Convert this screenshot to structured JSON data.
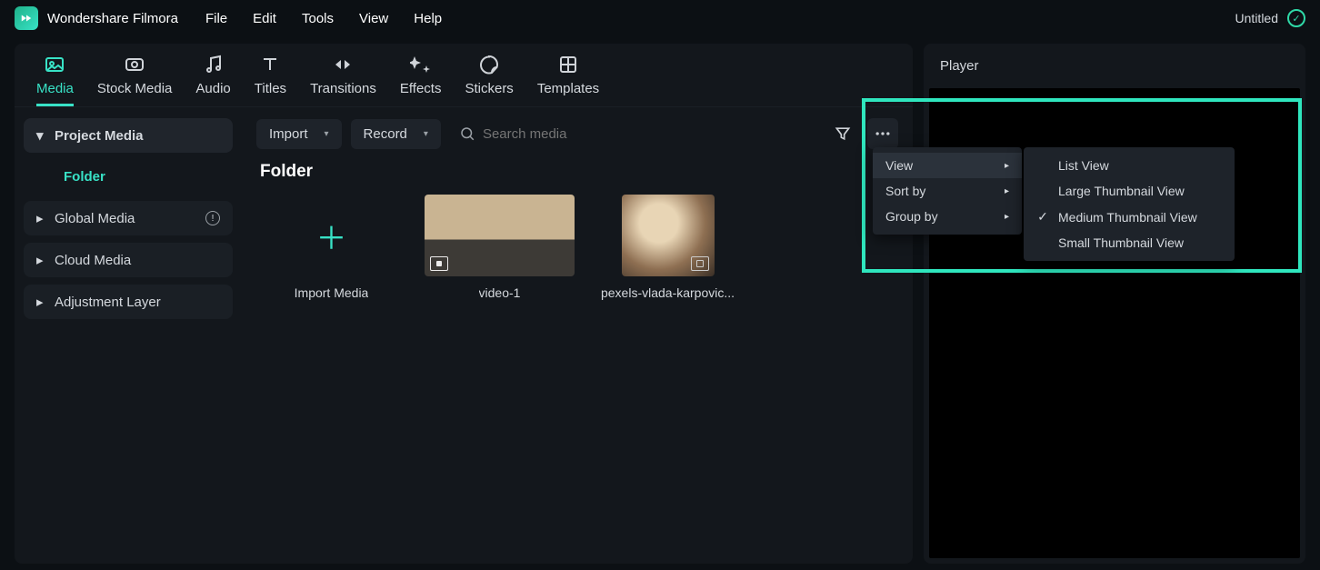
{
  "app_name": "Wondershare Filmora",
  "menu": [
    "File",
    "Edit",
    "Tools",
    "View",
    "Help"
  ],
  "project_title": "Untitled",
  "tabs": [
    {
      "label": "Media",
      "active": true
    },
    {
      "label": "Stock Media"
    },
    {
      "label": "Audio"
    },
    {
      "label": "Titles"
    },
    {
      "label": "Transitions"
    },
    {
      "label": "Effects"
    },
    {
      "label": "Stickers"
    },
    {
      "label": "Templates"
    }
  ],
  "sidebar": {
    "project_media": "Project Media",
    "folder": "Folder",
    "global_media": "Global Media",
    "cloud_media": "Cloud Media",
    "adjustment_layer": "Adjustment Layer"
  },
  "toolbar": {
    "import": "Import",
    "record": "Record",
    "search_placeholder": "Search media"
  },
  "folder_title": "Folder",
  "items": [
    {
      "label": "Import Media"
    },
    {
      "label": "video-1"
    },
    {
      "label": "pexels-vlada-karpovic..."
    }
  ],
  "ctx_main": [
    {
      "label": "View",
      "sub": true,
      "hover": true
    },
    {
      "label": "Sort by",
      "sub": true
    },
    {
      "label": "Group by",
      "sub": true
    }
  ],
  "ctx_view": [
    {
      "label": "List View"
    },
    {
      "label": "Large Thumbnail View"
    },
    {
      "label": "Medium Thumbnail View",
      "checked": true
    },
    {
      "label": "Small Thumbnail View"
    }
  ],
  "player_label": "Player"
}
